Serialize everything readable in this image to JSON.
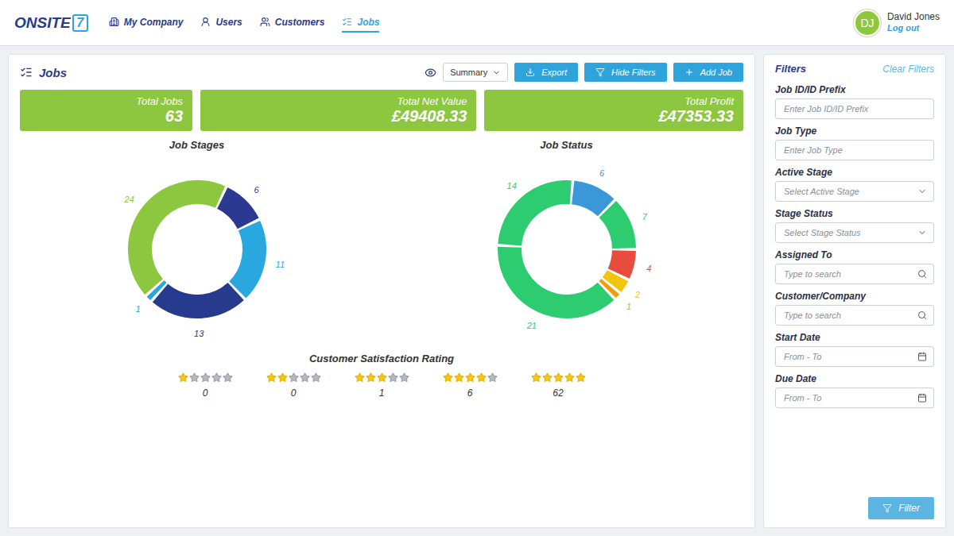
{
  "logo": {
    "text": "ONSITE",
    "mark": "7"
  },
  "nav": [
    {
      "label": "My Company",
      "icon": "company",
      "selected": false
    },
    {
      "label": "Users",
      "icon": "users",
      "selected": false
    },
    {
      "label": "Customers",
      "icon": "customers",
      "selected": false
    },
    {
      "label": "Jobs",
      "icon": "jobs",
      "selected": true
    }
  ],
  "user": {
    "initials": "DJ",
    "name": "David Jones",
    "logout": "Log out"
  },
  "page": {
    "title": "Jobs"
  },
  "toolbar": {
    "view": "Summary",
    "buttons": [
      {
        "label": "Export",
        "icon": "export"
      },
      {
        "label": "Hide Filters",
        "icon": "filter"
      },
      {
        "label": "Add Job",
        "icon": "add"
      }
    ]
  },
  "stats": [
    {
      "label": "Total Jobs",
      "value": "63"
    },
    {
      "label": "Total Net Value",
      "value": "£49408.33"
    },
    {
      "label": "Total Profit",
      "value": "£47353.33"
    }
  ],
  "charts": [
    {
      "title": "Job Stages",
      "segments": [
        {
          "value": 6,
          "label": "6",
          "color": "#2b3990"
        },
        {
          "value": 11,
          "label": "11",
          "color": "#29a8e0"
        },
        {
          "value": 13,
          "label": "13",
          "color": "#263a8e"
        },
        {
          "value": 1,
          "label": "1",
          "color": "#29a8e0"
        },
        {
          "value": 24,
          "label": "24",
          "color": "#8dc63f"
        }
      ]
    },
    {
      "title": "Job Status",
      "segments": [
        {
          "value": 6,
          "label": "6",
          "color": "#3a97d8"
        },
        {
          "value": 7,
          "label": "7",
          "color": "#2ecc71"
        },
        {
          "value": 4,
          "label": "4",
          "color": "#e74c3c"
        },
        {
          "value": 2,
          "label": "2",
          "color": "#f1c40f"
        },
        {
          "value": 1,
          "label": "1",
          "color": "#f39c12"
        },
        {
          "value": 21,
          "label": "21",
          "color": "#2ecc71"
        },
        {
          "value": 14,
          "label": "14",
          "color": "#2ecc71"
        }
      ]
    }
  ],
  "ratings": {
    "title": "Customer Satisfaction Rating",
    "items": [
      {
        "stars": 1,
        "max": 5,
        "count": "0"
      },
      {
        "stars": 2,
        "max": 5,
        "count": "0"
      },
      {
        "stars": 3,
        "max": 5,
        "count": "1"
      },
      {
        "stars": 4,
        "max": 5,
        "count": "6"
      },
      {
        "stars": 5,
        "max": 5,
        "count": "62"
      }
    ]
  },
  "filters": {
    "title": "Filters",
    "clear": "Clear Filters",
    "fields": [
      {
        "label": "Job ID/ID Prefix",
        "kind": "input",
        "placeholder": "Enter Job ID/ID Prefix"
      },
      {
        "label": "Job Type",
        "kind": "input",
        "placeholder": "Enter Job Type"
      },
      {
        "label": "Active Stage",
        "kind": "select",
        "placeholder": "Select Active Stage"
      },
      {
        "label": "Stage Status",
        "kind": "select",
        "placeholder": "Select Stage Status"
      },
      {
        "label": "Assigned To",
        "kind": "search",
        "placeholder": "Type to search"
      },
      {
        "label": "Customer/Company",
        "kind": "search",
        "placeholder": "Type to search"
      },
      {
        "label": "Start Date",
        "kind": "date",
        "placeholder": "From - To"
      },
      {
        "label": "Due Date",
        "kind": "date",
        "placeholder": "From - To"
      }
    ],
    "button": "Filter"
  }
}
